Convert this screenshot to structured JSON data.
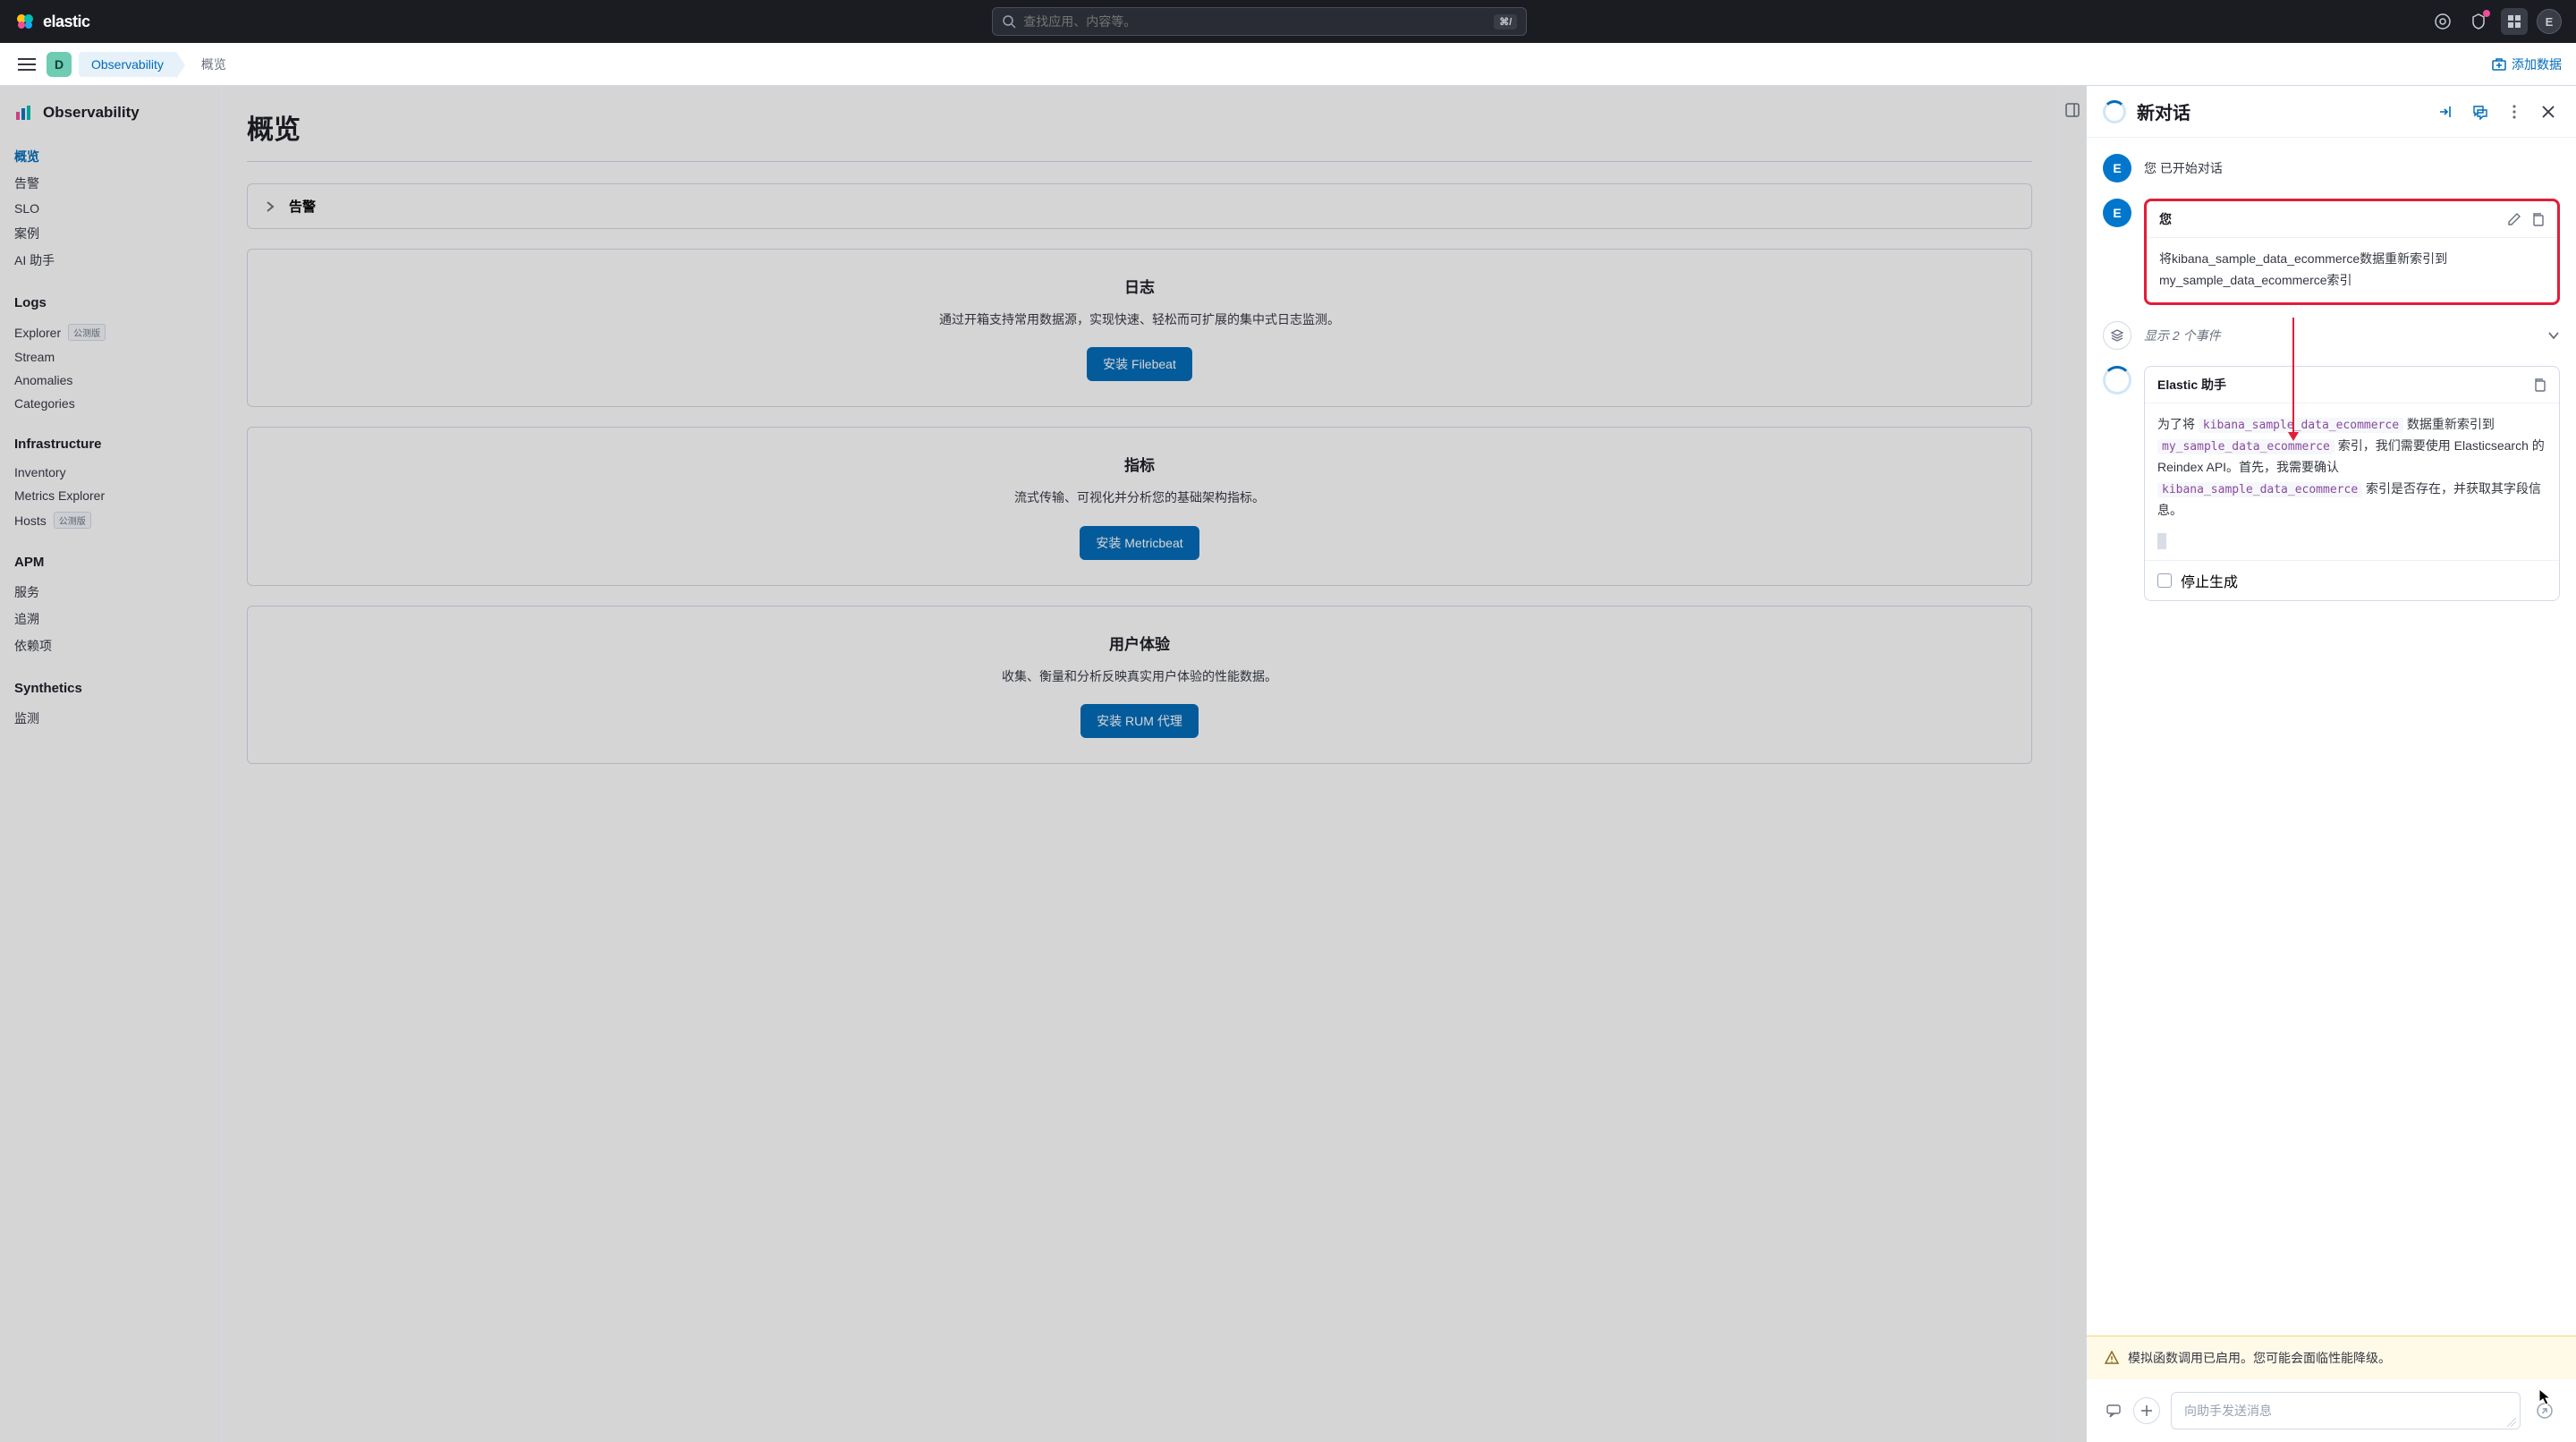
{
  "header": {
    "brand": "elastic",
    "search_placeholder": "查找应用、内容等。",
    "kbd_hint": "⌘/",
    "avatar_initial": "E"
  },
  "crumbs": {
    "space_initial": "D",
    "app": "Observability",
    "page": "概览",
    "add_data": "添加数据"
  },
  "sidebar": {
    "title": "Observability",
    "root": [
      {
        "label": "概览",
        "active": true
      },
      {
        "label": "告警"
      },
      {
        "label": "SLO"
      },
      {
        "label": "案例"
      },
      {
        "label": "AI 助手"
      }
    ],
    "groups": [
      {
        "label": "Logs",
        "items": [
          {
            "label": "Explorer",
            "beta": "公测版"
          },
          {
            "label": "Stream"
          },
          {
            "label": "Anomalies"
          },
          {
            "label": "Categories"
          }
        ]
      },
      {
        "label": "Infrastructure",
        "items": [
          {
            "label": "Inventory"
          },
          {
            "label": "Metrics Explorer"
          },
          {
            "label": "Hosts",
            "beta": "公测版"
          }
        ]
      },
      {
        "label": "APM",
        "items": [
          {
            "label": "服务"
          },
          {
            "label": "追溯"
          },
          {
            "label": "依赖项"
          }
        ]
      },
      {
        "label": "Synthetics",
        "items": [
          {
            "label": "监测"
          }
        ]
      }
    ]
  },
  "content": {
    "title": "概览",
    "accordion_alerts": "告警",
    "cards": [
      {
        "title": "日志",
        "desc": "通过开箱支持常用数据源，实现快速、轻松而可扩展的集中式日志监测。",
        "button": "安装 Filebeat"
      },
      {
        "title": "指标",
        "desc": "流式传输、可视化并分析您的基础架构指标。",
        "button": "安装 Metricbeat"
      },
      {
        "title": "用户体验",
        "desc": "收集、衡量和分析反映真实用户体验的性能数据。",
        "button": "安装 RUM 代理"
      }
    ]
  },
  "chat": {
    "title": "新对话",
    "started_prefix": "您",
    "started_suffix": "已开始对话",
    "user_label": "您",
    "user_message": "将kibana_sample_data_ecommerce数据重新索引到my_sample_data_ecommerce索引",
    "events_text": "显示 2 个事件",
    "assistant_label": "Elastic 助手",
    "assistant_response": {
      "part1": "为了将 ",
      "code1": "kibana_sample_data_ecommerce",
      "part2": " 数据重新索引到 ",
      "code2": "my_sample_data_ecommerce",
      "part3": " 索引，我们需要使用 Elasticsearch 的 Reindex API。首先，我需要确认 ",
      "code3": "kibana_sample_data_ecommerce",
      "part4": " 索引是否存在，并获取其字段信息。"
    },
    "stop_label": "停止生成",
    "warning": "模拟函数调用已启用。您可能会面临性能降级。",
    "input_placeholder": "向助手发送消息"
  }
}
